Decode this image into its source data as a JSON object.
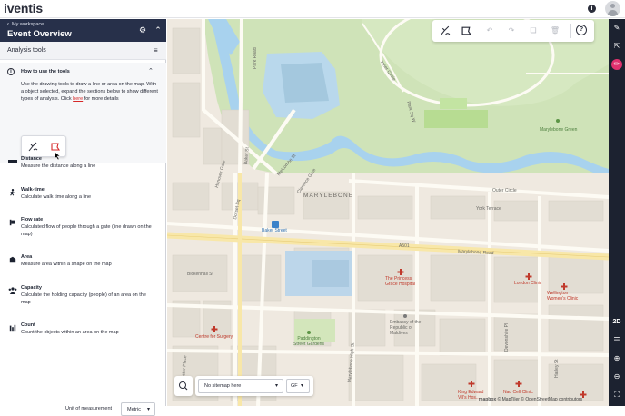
{
  "app": {
    "logo": "iventis",
    "info_icon": "info-icon",
    "avatar_icon": "user-avatar-icon"
  },
  "panel": {
    "breadcrumb": "My workspace",
    "title": "Event Overview",
    "subheader": "Analysis tools",
    "how_to": {
      "title": "How to use the tools",
      "desc_pre": "Use the drawing tools to draw a line or area on the map. With a object selected, expand the sections below to show different types of analysis. Click ",
      "link": "here",
      "desc_post": " for more details"
    },
    "tools": [
      {
        "name": "Distance",
        "desc": "Measure the distance along a line",
        "icon": "ruler-icon"
      },
      {
        "name": "Walk-time",
        "desc": "Calculate walk time along a line",
        "icon": "walking-icon"
      },
      {
        "name": "Flow rate",
        "desc": "Calculated flow of people through a gate (line drawn on the map)",
        "icon": "gate-icon"
      },
      {
        "name": "Area",
        "desc": "Measure area within a shape on the map",
        "icon": "area-icon"
      },
      {
        "name": "Capacity",
        "desc": "Calculate the holding capacity (people) of an area on the map",
        "icon": "people-icon"
      },
      {
        "name": "Count",
        "desc": "Count the objects within an area on the map",
        "icon": "count-icon"
      }
    ],
    "unit_label": "Unit of measurement",
    "unit_value": "Metric"
  },
  "map": {
    "labels": {
      "marylebone": "MARYLEBONE",
      "baker_street": "Baker Street",
      "marylebone_road": "Marylebone Road",
      "a501": "A501",
      "outer_circle": "Outer Circle",
      "york_terrace": "York Terrace",
      "princess_grace": "The Princess Grace Hospital",
      "london_clinic": "London Clinic",
      "wellington": "Wellington Women's Clinic",
      "embassy": "Embassy of the Republic of Maldives",
      "paddington_gardens": "Paddington Street Gardens",
      "centre_surgery": "Centre for Surgery",
      "marylebone_green": "Marylebone Green",
      "king_edward": "King Edward VII's Hos...",
      "nad_clinic": "Nad Cell Clinic",
      "bickenhall": "Bickenhall St",
      "park_road": "Park Road",
      "gloucester_place": "Gloucester Place",
      "devonshire": "Devonshire Pl",
      "harley": "Harley St",
      "clarence_gate": "Clarence Gate",
      "hanover_gate": "Hanover Gate",
      "inner_circle": "Inner Circle",
      "park_sq": "Park Sq W",
      "dorset_sq": "Dorset Sq",
      "melcombe": "Melcombe St",
      "marylebone_high": "Marylebone High St",
      "baker_st_label": "Baker St"
    },
    "search_placeholder": "No sitemap here",
    "level": "GF",
    "attribution": "© MapTiler © OpenStreetMap contributors",
    "mapbox": "mapbox"
  },
  "right_bar": {
    "mode_2d": "2D"
  },
  "colors": {
    "header_bg": "#27304a",
    "accent": "#e0316e",
    "right_bar_bg": "#1c2230",
    "park": "#cfe3b8",
    "water": "#a8d2ee",
    "road_major": "#f8e7a8"
  }
}
